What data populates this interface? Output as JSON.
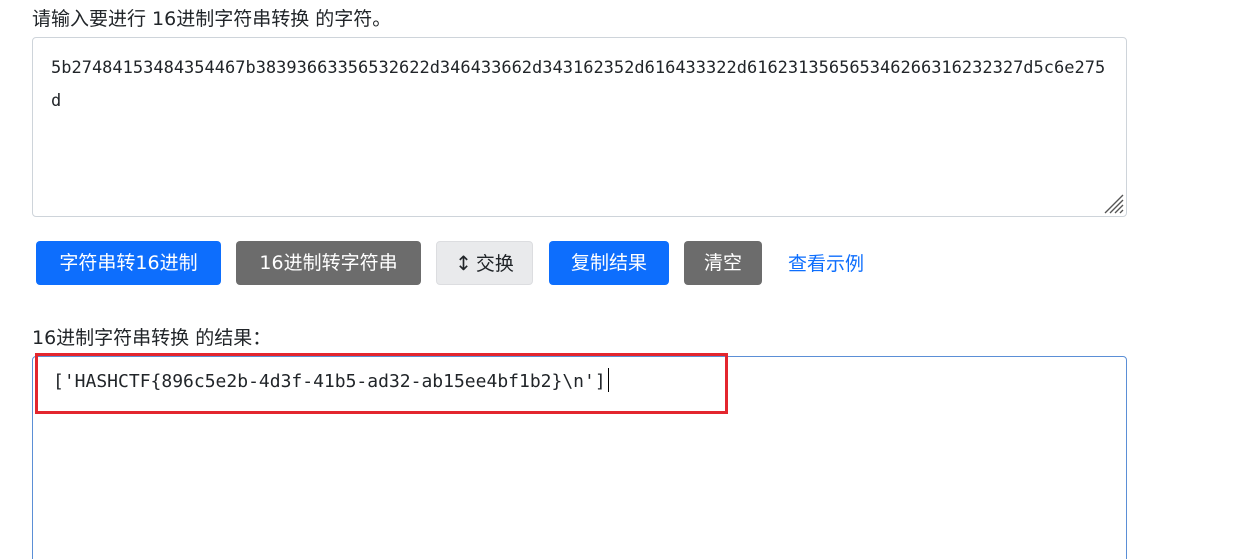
{
  "input": {
    "label": "请输入要进行 16进制字符串转换 的字符。",
    "value": "5b27484153484354467b38393663356532622d346433662d343162352d616433322d616231356565346266316232327d5c6e275d"
  },
  "buttons": {
    "str_to_hex": "字符串转16进制",
    "hex_to_str": "16进制转字符串",
    "swap": "交换",
    "swap_icon": "↕",
    "copy": "复制结果",
    "clear": "清空",
    "example_link": "查看示例"
  },
  "output": {
    "label": "16进制字符串转换 的结果：",
    "value": "['HASHCTF{896c5e2b-4d3f-41b5-ad32-ab15ee4bf1b2}\\n']"
  },
  "colors": {
    "primary": "#0d6efd",
    "secondary": "#6c6c6c",
    "highlight": "#e3262e"
  }
}
